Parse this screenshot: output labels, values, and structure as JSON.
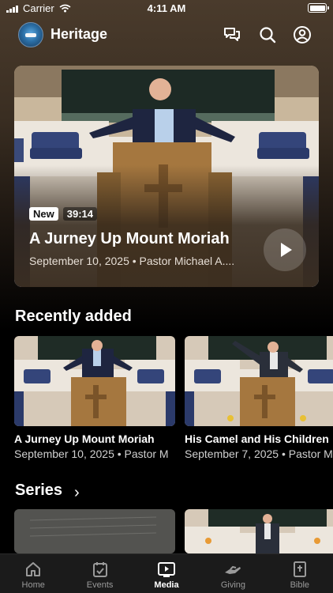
{
  "status_bar": {
    "carrier": "Carrier",
    "time": "4:11 AM"
  },
  "header": {
    "title": "Heritage",
    "icons": [
      "logo",
      "chat-icon",
      "search-icon",
      "profile-icon"
    ]
  },
  "featured": {
    "badge": "New",
    "duration": "39:14",
    "title": "A Jurney Up Mount Moriah",
    "meta": "September 10, 2025 • Pastor Michael A...."
  },
  "recently_added": {
    "title": "Recently added",
    "items": [
      {
        "title": "A Jurney Up Mount Moriah",
        "meta": "September 10, 2025 • Pastor M"
      },
      {
        "title": "His Camel and His Children",
        "meta": "September 7, 2025 • Pastor M"
      }
    ]
  },
  "series": {
    "title": "Series"
  },
  "tabbar": {
    "items": [
      {
        "label": "Home",
        "icon": "home-icon"
      },
      {
        "label": "Events",
        "icon": "calendar-icon"
      },
      {
        "label": "Media",
        "icon": "play-icon",
        "active": true
      },
      {
        "label": "Giving",
        "icon": "hand-icon"
      },
      {
        "label": "Bible",
        "icon": "bible-icon"
      }
    ]
  }
}
